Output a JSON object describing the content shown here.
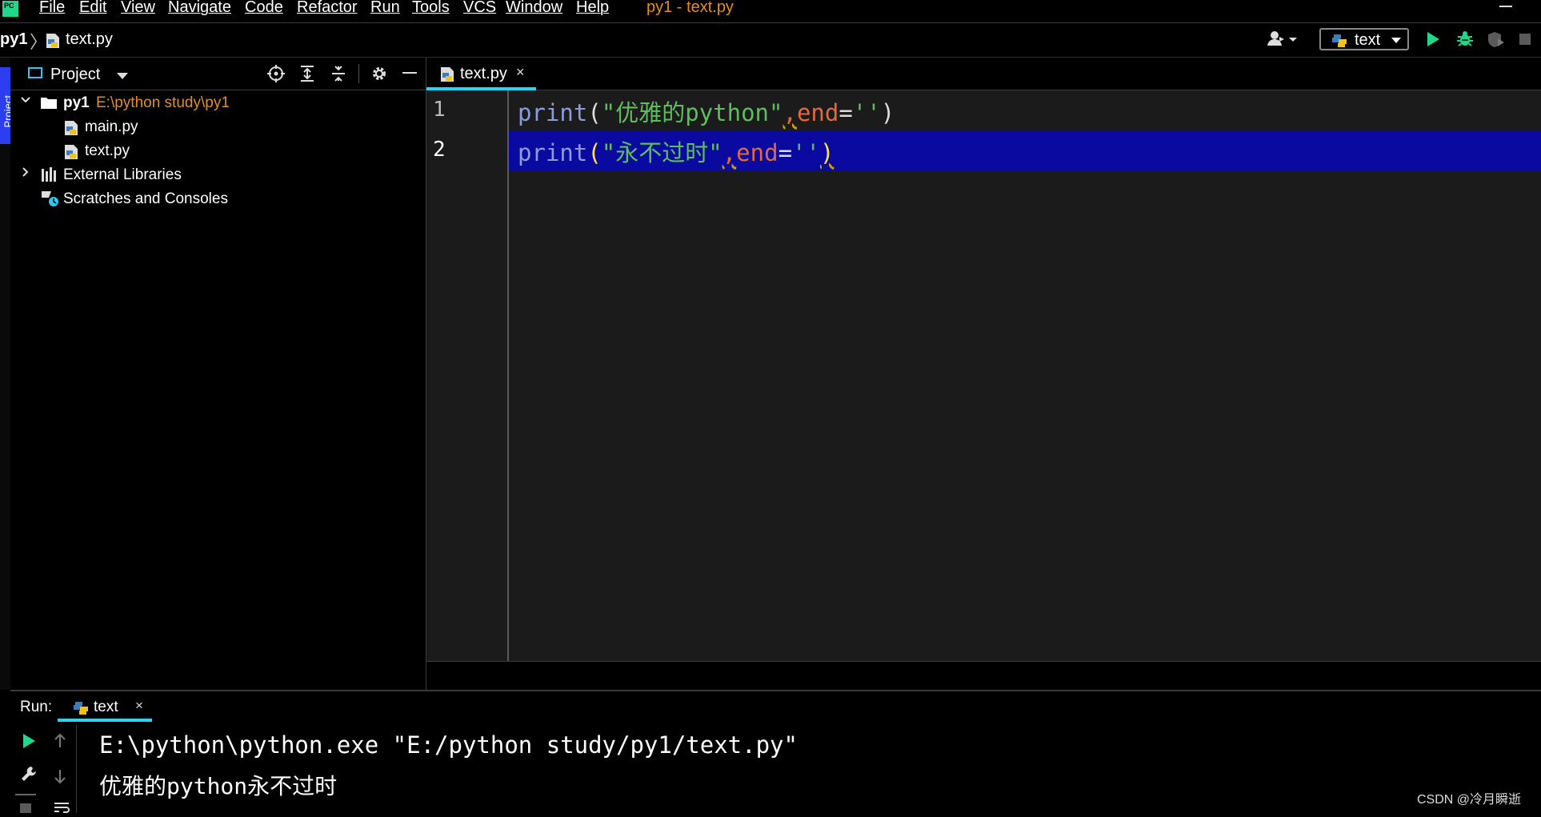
{
  "menubar": {
    "logo": "PC",
    "items": [
      "File",
      "Edit",
      "View",
      "Navigate",
      "Code",
      "Refactor",
      "Run",
      "Tools",
      "VCS",
      "Window",
      "Help"
    ],
    "window_title": "py1 - text.py"
  },
  "navbar": {
    "project": "py1",
    "separator": "〉",
    "file": "text.py",
    "run_config": "text"
  },
  "strip": {
    "project_label": "Project"
  },
  "project_panel": {
    "title": "Project",
    "root": {
      "name": "py1",
      "path": "E:\\python study\\py1"
    },
    "files": [
      "main.py",
      "text.py"
    ],
    "external": "External Libraries",
    "scratches": "Scratches and Consoles"
  },
  "editor": {
    "tab_label": "text.py",
    "tab_close": "×",
    "line_numbers": [
      "1",
      "2"
    ],
    "lines": [
      {
        "fn": "print",
        "open": "(",
        "str": "\"优雅的python\"",
        "comma": ",",
        "kw": "end",
        "eq": "=",
        "empty": "''",
        "close": ")"
      },
      {
        "fn": "print",
        "open": "(",
        "str": "\"永不过时\"",
        "comma": ",",
        "kw": "end",
        "eq": "=",
        "empty": "''",
        "close": ")"
      }
    ]
  },
  "run_panel": {
    "label": "Run:",
    "tab_label": "text",
    "tab_close": "×",
    "output": [
      "E:\\python\\python.exe \"E:/python study/py1/text.py\"",
      "优雅的python永不过时"
    ]
  },
  "watermark": "CSDN @冷月瞬逝",
  "colors": {
    "accent_cyan": "#2ed3f0",
    "current_line": "#0a0aa0",
    "string_green": "#5cbf5c",
    "keyword_orange": "#e06a3d",
    "function_blue": "#8a9cdc",
    "title_orange": "#e58c25",
    "run_green": "#21d789"
  }
}
